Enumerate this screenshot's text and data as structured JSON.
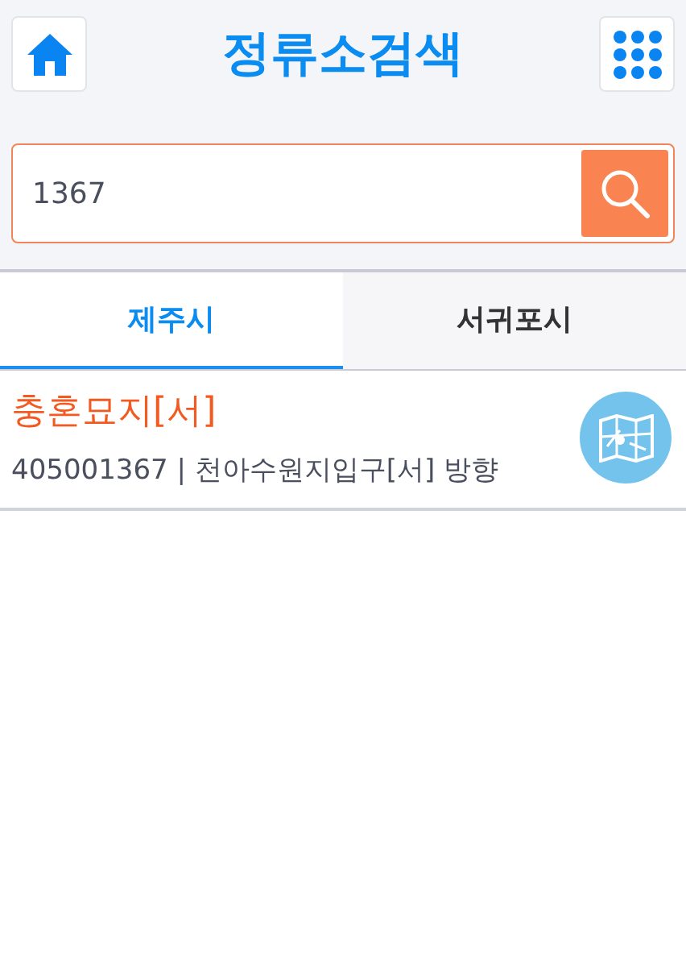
{
  "header": {
    "title": "정류소검색"
  },
  "search": {
    "value": "1367"
  },
  "tabs": [
    {
      "label": "제주시",
      "selected": true
    },
    {
      "label": "서귀포시",
      "selected": false
    }
  ],
  "results": [
    {
      "name": "충혼묘지[서]",
      "detail": "405001367 | 천아수원지입구[서] 방향"
    }
  ]
}
